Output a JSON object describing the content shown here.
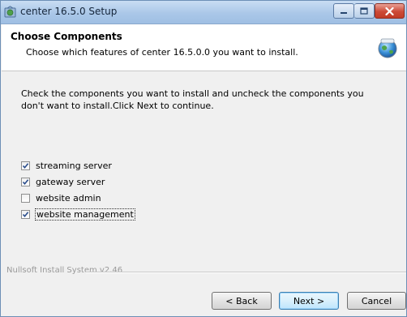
{
  "window": {
    "title": "center 16.5.0 Setup"
  },
  "header": {
    "title": "Choose Components",
    "subtitle": "Choose which features of center 16.5.0.0 you want to install."
  },
  "description": "Check the components you want to install and uncheck the components you don't want to install.Click Next to continue.",
  "components": [
    {
      "label": "streaming server",
      "checked": true
    },
    {
      "label": "gateway server",
      "checked": true
    },
    {
      "label": "website admin",
      "checked": false
    },
    {
      "label": "website management",
      "checked": true
    }
  ],
  "footer": {
    "branding": "Nullsoft Install System v2.46"
  },
  "buttons": {
    "back": "< Back",
    "next": "Next >",
    "cancel": "Cancel"
  },
  "colors": {
    "titlebar": "#aac7e8",
    "close_button": "#cc4a37",
    "checkmark": "#2a4d8c"
  },
  "icons": {
    "app": "installer-globe-icon",
    "header": "installer-globe-icon",
    "minimize": "minimize-icon",
    "maximize": "maximize-icon",
    "close": "close-icon",
    "checkbox": "checkbox-checked-icon"
  }
}
